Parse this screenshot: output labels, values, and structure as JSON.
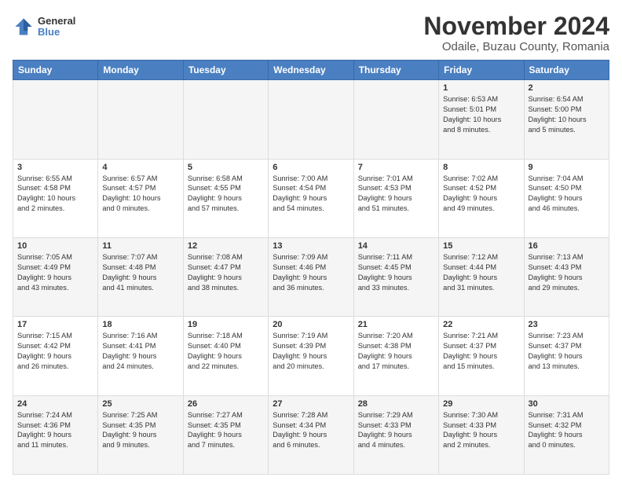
{
  "header": {
    "logo_general": "General",
    "logo_blue": "Blue",
    "month_title": "November 2024",
    "location": "Odaile, Buzau County, Romania"
  },
  "days_of_week": [
    "Sunday",
    "Monday",
    "Tuesday",
    "Wednesday",
    "Thursday",
    "Friday",
    "Saturday"
  ],
  "weeks": [
    [
      {
        "day": "",
        "info": ""
      },
      {
        "day": "",
        "info": ""
      },
      {
        "day": "",
        "info": ""
      },
      {
        "day": "",
        "info": ""
      },
      {
        "day": "",
        "info": ""
      },
      {
        "day": "1",
        "info": "Sunrise: 6:53 AM\nSunset: 5:01 PM\nDaylight: 10 hours\nand 8 minutes."
      },
      {
        "day": "2",
        "info": "Sunrise: 6:54 AM\nSunset: 5:00 PM\nDaylight: 10 hours\nand 5 minutes."
      }
    ],
    [
      {
        "day": "3",
        "info": "Sunrise: 6:55 AM\nSunset: 4:58 PM\nDaylight: 10 hours\nand 2 minutes."
      },
      {
        "day": "4",
        "info": "Sunrise: 6:57 AM\nSunset: 4:57 PM\nDaylight: 10 hours\nand 0 minutes."
      },
      {
        "day": "5",
        "info": "Sunrise: 6:58 AM\nSunset: 4:55 PM\nDaylight: 9 hours\nand 57 minutes."
      },
      {
        "day": "6",
        "info": "Sunrise: 7:00 AM\nSunset: 4:54 PM\nDaylight: 9 hours\nand 54 minutes."
      },
      {
        "day": "7",
        "info": "Sunrise: 7:01 AM\nSunset: 4:53 PM\nDaylight: 9 hours\nand 51 minutes."
      },
      {
        "day": "8",
        "info": "Sunrise: 7:02 AM\nSunset: 4:52 PM\nDaylight: 9 hours\nand 49 minutes."
      },
      {
        "day": "9",
        "info": "Sunrise: 7:04 AM\nSunset: 4:50 PM\nDaylight: 9 hours\nand 46 minutes."
      }
    ],
    [
      {
        "day": "10",
        "info": "Sunrise: 7:05 AM\nSunset: 4:49 PM\nDaylight: 9 hours\nand 43 minutes."
      },
      {
        "day": "11",
        "info": "Sunrise: 7:07 AM\nSunset: 4:48 PM\nDaylight: 9 hours\nand 41 minutes."
      },
      {
        "day": "12",
        "info": "Sunrise: 7:08 AM\nSunset: 4:47 PM\nDaylight: 9 hours\nand 38 minutes."
      },
      {
        "day": "13",
        "info": "Sunrise: 7:09 AM\nSunset: 4:46 PM\nDaylight: 9 hours\nand 36 minutes."
      },
      {
        "day": "14",
        "info": "Sunrise: 7:11 AM\nSunset: 4:45 PM\nDaylight: 9 hours\nand 33 minutes."
      },
      {
        "day": "15",
        "info": "Sunrise: 7:12 AM\nSunset: 4:44 PM\nDaylight: 9 hours\nand 31 minutes."
      },
      {
        "day": "16",
        "info": "Sunrise: 7:13 AM\nSunset: 4:43 PM\nDaylight: 9 hours\nand 29 minutes."
      }
    ],
    [
      {
        "day": "17",
        "info": "Sunrise: 7:15 AM\nSunset: 4:42 PM\nDaylight: 9 hours\nand 26 minutes."
      },
      {
        "day": "18",
        "info": "Sunrise: 7:16 AM\nSunset: 4:41 PM\nDaylight: 9 hours\nand 24 minutes."
      },
      {
        "day": "19",
        "info": "Sunrise: 7:18 AM\nSunset: 4:40 PM\nDaylight: 9 hours\nand 22 minutes."
      },
      {
        "day": "20",
        "info": "Sunrise: 7:19 AM\nSunset: 4:39 PM\nDaylight: 9 hours\nand 20 minutes."
      },
      {
        "day": "21",
        "info": "Sunrise: 7:20 AM\nSunset: 4:38 PM\nDaylight: 9 hours\nand 17 minutes."
      },
      {
        "day": "22",
        "info": "Sunrise: 7:21 AM\nSunset: 4:37 PM\nDaylight: 9 hours\nand 15 minutes."
      },
      {
        "day": "23",
        "info": "Sunrise: 7:23 AM\nSunset: 4:37 PM\nDaylight: 9 hours\nand 13 minutes."
      }
    ],
    [
      {
        "day": "24",
        "info": "Sunrise: 7:24 AM\nSunset: 4:36 PM\nDaylight: 9 hours\nand 11 minutes."
      },
      {
        "day": "25",
        "info": "Sunrise: 7:25 AM\nSunset: 4:35 PM\nDaylight: 9 hours\nand 9 minutes."
      },
      {
        "day": "26",
        "info": "Sunrise: 7:27 AM\nSunset: 4:35 PM\nDaylight: 9 hours\nand 7 minutes."
      },
      {
        "day": "27",
        "info": "Sunrise: 7:28 AM\nSunset: 4:34 PM\nDaylight: 9 hours\nand 6 minutes."
      },
      {
        "day": "28",
        "info": "Sunrise: 7:29 AM\nSunset: 4:33 PM\nDaylight: 9 hours\nand 4 minutes."
      },
      {
        "day": "29",
        "info": "Sunrise: 7:30 AM\nSunset: 4:33 PM\nDaylight: 9 hours\nand 2 minutes."
      },
      {
        "day": "30",
        "info": "Sunrise: 7:31 AM\nSunset: 4:32 PM\nDaylight: 9 hours\nand 0 minutes."
      }
    ]
  ]
}
